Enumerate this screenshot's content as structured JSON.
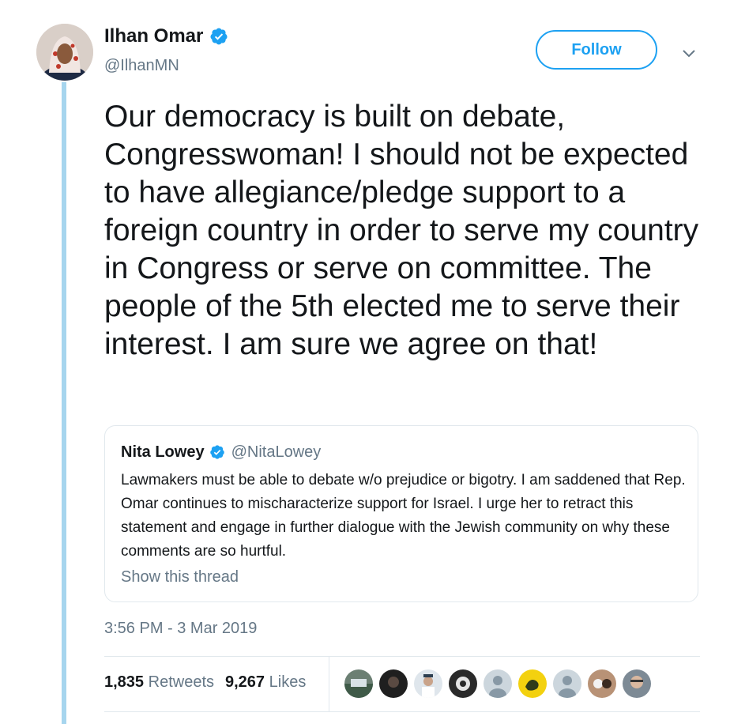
{
  "author": {
    "name": "Ilhan Omar",
    "handle": "@IlhanMN",
    "verified_icon": "verified-badge-icon"
  },
  "header": {
    "follow_label": "Follow",
    "menu_icon": "chevron-down-icon"
  },
  "tweet": {
    "text": "Our democracy is built on debate, Congresswoman! I should not be expected to have allegiance/pledge support to a foreign country in order to serve my country in Congress or serve on committee. The people of the 5th elected me to serve their interest. I am sure we agree on that!",
    "timestamp": "3:56 PM - 3 Mar 2019"
  },
  "quoted": {
    "name": "Nita Lowey",
    "handle": "@NitaLowey",
    "text": "Lawmakers must be able to debate w/o prejudice or bigotry. I am saddened that Rep. Omar continues to mischaracterize support for Israel. I urge her to retract this statement and engage in further dialogue with the Jewish community on why these comments are so hurtful.",
    "show_thread": "Show this thread"
  },
  "stats": {
    "retweets_count": "1,835",
    "retweets_label": "Retweets",
    "likes_count": "9,267",
    "likes_label": "Likes"
  },
  "colors": {
    "accent": "#1da1f2",
    "thread_line": "#a6d5ee",
    "secondary_text": "#657786"
  }
}
